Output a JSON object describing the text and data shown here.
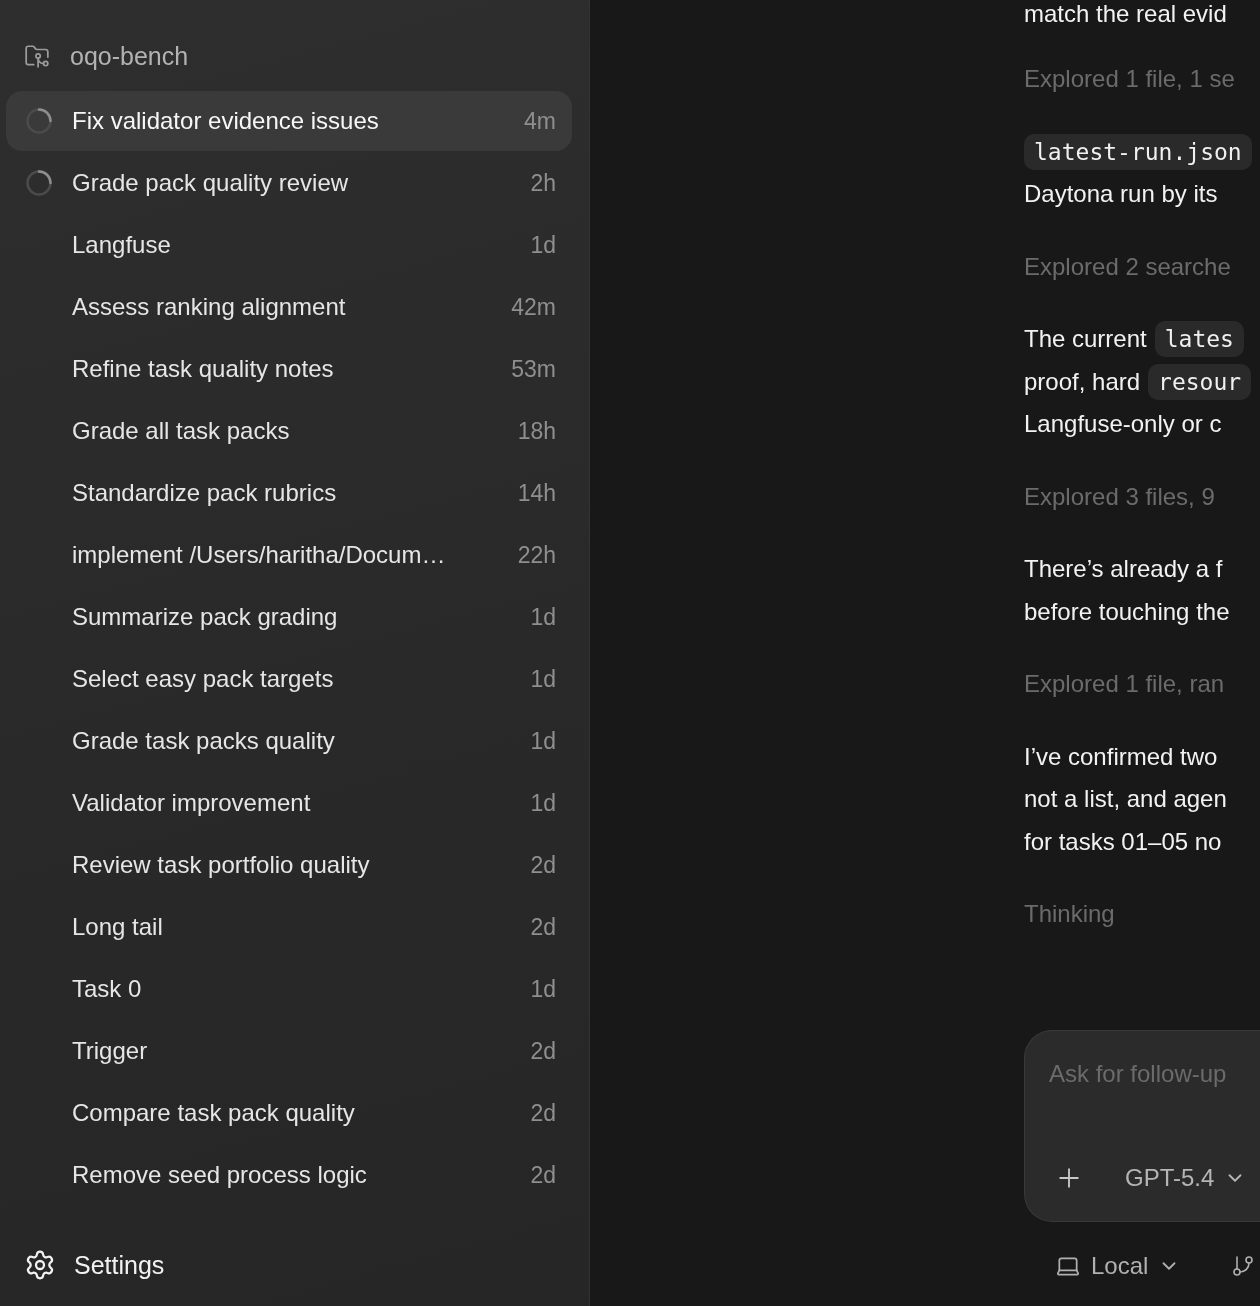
{
  "sidebar": {
    "project": {
      "name": "oqo-bench"
    },
    "threads": [
      {
        "title": "Fix validator evidence issues",
        "time": "4m",
        "running": true,
        "selected": true
      },
      {
        "title": "Grade pack quality review",
        "time": "2h",
        "running": true,
        "selected": false
      },
      {
        "title": "Langfuse",
        "time": "1d",
        "running": false,
        "selected": false
      },
      {
        "title": "Assess ranking alignment",
        "time": "42m",
        "running": false,
        "selected": false
      },
      {
        "title": "Refine task quality notes",
        "time": "53m",
        "running": false,
        "selected": false
      },
      {
        "title": "Grade all task packs",
        "time": "18h",
        "running": false,
        "selected": false
      },
      {
        "title": "Standardize pack rubrics",
        "time": "14h",
        "running": false,
        "selected": false
      },
      {
        "title": "implement /Users/haritha/Docum…",
        "time": "22h",
        "running": false,
        "selected": false
      },
      {
        "title": "Summarize pack grading",
        "time": "1d",
        "running": false,
        "selected": false
      },
      {
        "title": "Select easy pack targets",
        "time": "1d",
        "running": false,
        "selected": false
      },
      {
        "title": "Grade task packs quality",
        "time": "1d",
        "running": false,
        "selected": false
      },
      {
        "title": "Validator improvement",
        "time": "1d",
        "running": false,
        "selected": false
      },
      {
        "title": "Review task portfolio quality",
        "time": "2d",
        "running": false,
        "selected": false
      },
      {
        "title": "Long tail",
        "time": "2d",
        "running": false,
        "selected": false
      },
      {
        "title": "Task 0",
        "time": "1d",
        "running": false,
        "selected": false
      },
      {
        "title": "Trigger",
        "time": "2d",
        "running": false,
        "selected": false
      },
      {
        "title": "Compare task pack quality",
        "time": "2d",
        "running": false,
        "selected": false
      },
      {
        "title": "Remove seed process logic",
        "time": "2d",
        "running": false,
        "selected": false
      }
    ],
    "settings": {
      "label": "Settings"
    }
  },
  "conversation": {
    "blocks": [
      {
        "kind": "message",
        "lines": [
          [
            {
              "kind": "text",
              "text": "match the real evid"
            }
          ]
        ]
      },
      {
        "kind": "activity",
        "text": "Explored 1 file, 1 se"
      },
      {
        "kind": "message",
        "lines": [
          [
            {
              "kind": "code",
              "text": "latest-run.json"
            }
          ],
          [
            {
              "kind": "text",
              "text": "Daytona run by its"
            }
          ]
        ]
      },
      {
        "kind": "activity",
        "text": "Explored 2 searche"
      },
      {
        "kind": "message",
        "lines": [
          [
            {
              "kind": "text",
              "text": "The current"
            },
            {
              "kind": "code",
              "text": "lates"
            }
          ],
          [
            {
              "kind": "text",
              "text": "proof, hard"
            },
            {
              "kind": "code",
              "text": "resour"
            }
          ],
          [
            {
              "kind": "text",
              "text": "Langfuse-only or c"
            }
          ]
        ]
      },
      {
        "kind": "activity",
        "text": "Explored 3 files, 9"
      },
      {
        "kind": "message",
        "lines": [
          [
            {
              "kind": "text",
              "text": "There’s already a f"
            }
          ],
          [
            {
              "kind": "text",
              "text": "before touching the"
            }
          ]
        ]
      },
      {
        "kind": "activity",
        "text": "Explored 1 file, ran"
      },
      {
        "kind": "message",
        "lines": [
          [
            {
              "kind": "text",
              "text": "I’ve confirmed two"
            }
          ],
          [
            {
              "kind": "text",
              "text": "not a list, and agen"
            }
          ],
          [
            {
              "kind": "text",
              "text": "for tasks 01–05 no"
            }
          ]
        ]
      },
      {
        "kind": "activity",
        "text": "Thinking"
      }
    ]
  },
  "composer": {
    "placeholder": "Ask for follow-up",
    "model": "GPT-5.4"
  },
  "footer": {
    "environment": "Local"
  }
}
